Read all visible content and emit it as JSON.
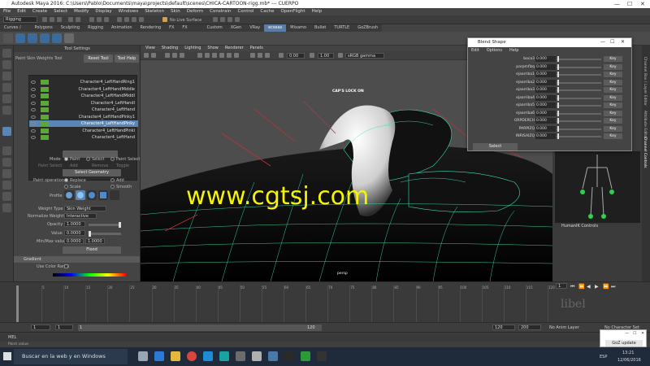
{
  "window": {
    "title": "Autodesk Maya 2016: C:\\Users\\Pablo\\Documents\\maya\\projects\\default\\scenes\\CHICA-CARTOON-rigg.mb* --- CUERPO"
  },
  "menu": [
    "File",
    "Edit",
    "Create",
    "Select",
    "Modify",
    "Display",
    "Windows",
    "Skeleton",
    "Skin",
    "Deform",
    "Constrain",
    "Control",
    "Cache",
    "OpenFlight",
    "Help"
  ],
  "status_line": {
    "mode": "Rigging",
    "no_live_surface": "No Live Surface"
  },
  "shelf_tabs": [
    "Curves / Surfaces",
    "Polygons",
    "Sculpting",
    "Rigging",
    "Animation",
    "Rendering",
    "FX",
    "FX Caching",
    "Custom",
    "XGen",
    "VRay",
    "ecseas",
    "Mixamo",
    "Bullet",
    "TURTLE",
    "GoZBrush"
  ],
  "shelf_active_tab": "ecseas",
  "tool_settings": {
    "header": "Tool Settings",
    "tool_name": "Paint Skin Weights Tool",
    "reset": "Reset Tool",
    "help": "Tool Help",
    "influences": [
      "Character4_LeftHandRing1",
      "Character4_LeftHandMiddle",
      "Character4_LeftHandMiddl",
      "Character4_LeftHandI",
      "Character4_LeftHand",
      "Character4_LeftHandPinky1",
      "Character4_LeftHandPinky",
      "Character4_LeftHandPinki",
      "Character4_LeftHand"
    ],
    "selected_index": 6,
    "mode_label": "Mode",
    "mode_options": [
      "Paint",
      "Select",
      "Paint Select"
    ],
    "paint_select_label": "Paint Select",
    "paint_select_options": [
      "Add",
      "Remove",
      "Toggle"
    ],
    "select_geometry": "Select Geometry",
    "paint_operation_label": "Paint operation",
    "paint_operations": [
      "Replace",
      "Add",
      "Scale",
      "Smooth"
    ],
    "profile_label": "Profile",
    "weight_type_label": "Weight Type",
    "weight_type": "Skin Weight",
    "normalize_label": "Normalize Weights",
    "normalize": "Interactive",
    "opacity_label": "Opacity",
    "opacity": "1.0000",
    "value_label": "Value",
    "value": "0.0000",
    "minmax_label": "Min/Max value",
    "min": "0.0000",
    "max": "1.0000",
    "flood": "Flood",
    "gradient_section": "Gradient",
    "use_color_ramp": "Use Color Ramp"
  },
  "viewport": {
    "menu": [
      "View",
      "Shading",
      "Lighting",
      "Show",
      "Renderer",
      "Panels"
    ],
    "field_a": "0.00",
    "field_b": "1.00",
    "colorspace": "sRGB gamma",
    "caps_lock": "CAP'S LOCK ON",
    "camera": "persp",
    "watermark": "www.cgtsj.com"
  },
  "blend_shape": {
    "title": "Blend Shape",
    "menu": [
      "Edit",
      "Options",
      "Help"
    ],
    "rows": [
      {
        "name": "boca3",
        "value": "0.000"
      },
      {
        "name": "parpmflzq",
        "value": "0.000"
      },
      {
        "name": "ejaarriba1",
        "value": "0.000"
      },
      {
        "name": "ejaarriba2",
        "value": "0.000"
      },
      {
        "name": "ejaarriba3",
        "value": "0.000"
      },
      {
        "name": "ejaarriba4",
        "value": "0.000"
      },
      {
        "name": "ejaarriba5",
        "value": "0.000"
      },
      {
        "name": "ejaarriba6",
        "value": "0.000"
      },
      {
        "name": "ORPDERCH",
        "value": "0.000"
      },
      {
        "name": "PARPIZQ",
        "value": "0.000"
      },
      {
        "name": "INRISAIZQ",
        "value": "0.000"
      }
    ],
    "key_label": "Key",
    "select_label": "Select"
  },
  "right_panel": {
    "humanik_controls": "HumanIK Controls",
    "side_tabs": [
      "Channel Box / Layer Editor",
      "Attribute Editor",
      "Channel Controls"
    ]
  },
  "time_slider": {
    "ticks": [
      "5",
      "10",
      "15",
      "20",
      "25",
      "30",
      "35",
      "40",
      "45",
      "50",
      "55",
      "60",
      "65",
      "70",
      "75",
      "80",
      "85",
      "90",
      "95",
      "100",
      "105",
      "110",
      "115",
      "120"
    ],
    "current_frame": "1"
  },
  "range_slider": {
    "start": "1",
    "inner_start": "1",
    "inner_end": "120",
    "end_a": "120",
    "end_b": "200",
    "anim_layer": "No Anim Layer",
    "character_set": "No Character Set"
  },
  "mel": {
    "label": "MEL"
  },
  "help_line": "Paint value",
  "goz": {
    "label": "GoZ update"
  },
  "taskbar": {
    "search": "Buscar en la web y en Windows",
    "lang": "ESP",
    "time": "13:21",
    "date": "12/06/2016"
  },
  "brand_watermark": "libel"
}
